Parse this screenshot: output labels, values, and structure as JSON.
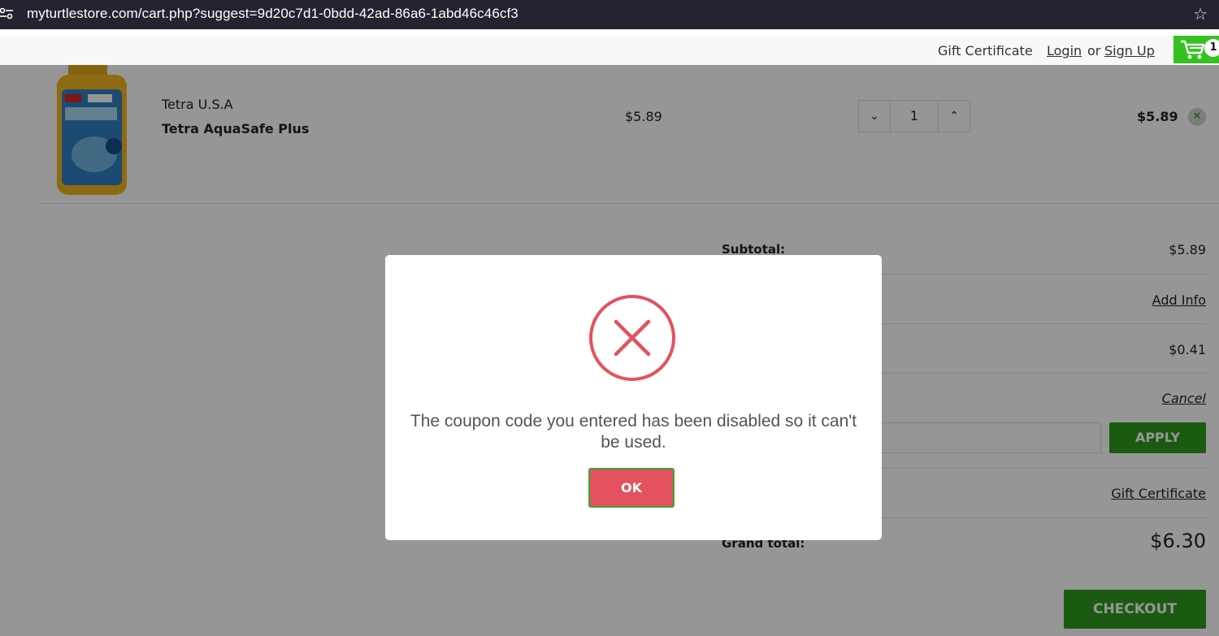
{
  "browser": {
    "url": "myturtlestore.com/cart.php?suggest=9d20c7d1-0bdd-42ad-86a6-1abd46c46cf3",
    "bar_color": "#27222f"
  },
  "header": {
    "gift_certificate": "Gift Certificate",
    "login": "Login",
    "or": "or",
    "sign_up": "Sign Up",
    "cart_count": "1",
    "cart_color": "#35c21e"
  },
  "cart": {
    "item": {
      "brand": "Tetra U.S.A",
      "name": "Tetra AquaSafe Plus",
      "price": "$5.89",
      "quantity": "1",
      "total": "$5.89",
      "image_icon": "product-bottle-image"
    }
  },
  "summary": {
    "subtotal_label": "Subtotal:",
    "subtotal_value": "$5.89",
    "add_info": "Add Info",
    "tax_value": "$0.41",
    "cancel": "Cancel",
    "apply_label": "APPLY",
    "gift_certificate": "Gift Certificate",
    "grand_total_label": "Grand total:",
    "grand_total_value": "$6.30",
    "checkout_label": "CHECKOUT",
    "button_color": "#2f9a1e"
  },
  "modal": {
    "message": "The coupon code you entered has been disabled so it can't be used.",
    "ok_label": "OK",
    "icon": "error-x-icon",
    "error_color": "#e4525f"
  }
}
